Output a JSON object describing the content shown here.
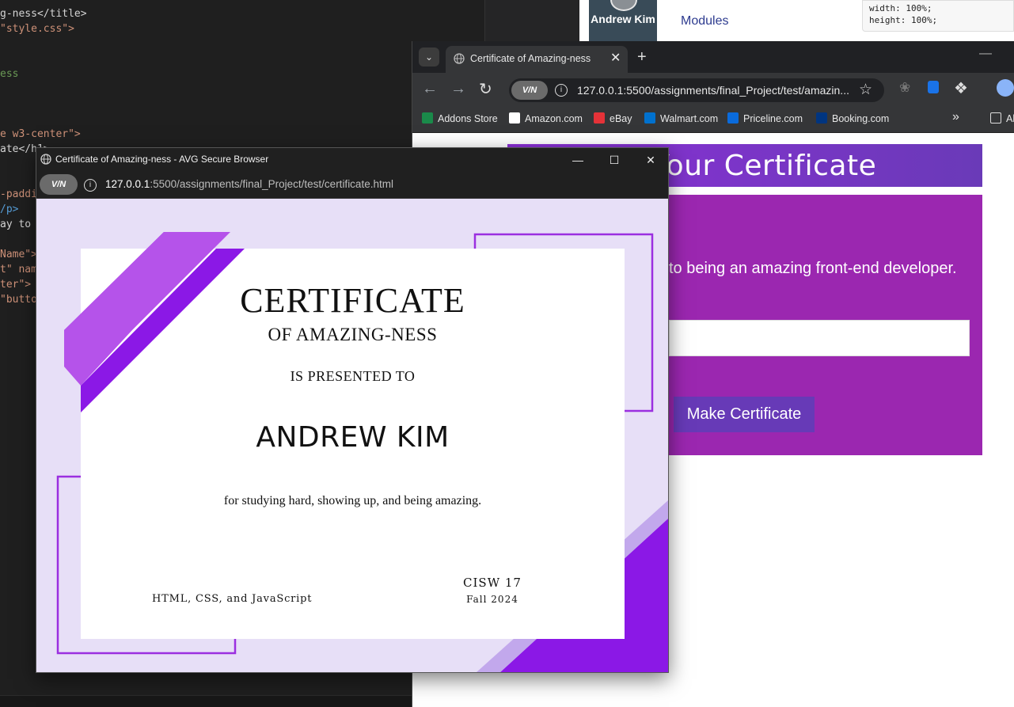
{
  "editor": {
    "lines": [
      {
        "text": "g-ness</title>",
        "cls": "c-txt"
      },
      {
        "text": "\"style.css\">",
        "cls": "c-str"
      },
      {
        "text": "",
        "cls": "c-txt"
      },
      {
        "text": "",
        "cls": "c-txt"
      },
      {
        "text": "ess",
        "cls": "c-cmt"
      },
      {
        "text": "",
        "cls": "c-txt"
      },
      {
        "text": "",
        "cls": "c-txt"
      },
      {
        "text": "",
        "cls": "c-txt"
      },
      {
        "text": "e w3-center\">",
        "cls": "c-str"
      },
      {
        "text": "ate</h1>",
        "cls": "c-txt"
      },
      {
        "text": "",
        "cls": "c-txt"
      },
      {
        "text": "",
        "cls": "c-txt"
      },
      {
        "text": "-paddi",
        "cls": "c-str"
      },
      {
        "text": "/p>",
        "cls": "c-tag"
      },
      {
        "text": "ay to",
        "cls": "c-txt"
      },
      {
        "text": "",
        "cls": "c-txt"
      },
      {
        "text": "Name\">",
        "cls": "c-str"
      },
      {
        "text": "t\" nam",
        "cls": "c-str"
      },
      {
        "text": "ter\">",
        "cls": "c-str"
      },
      {
        "text": "\"butto",
        "cls": "c-str"
      }
    ]
  },
  "canvas": {
    "user_name": "Andrew Kim",
    "modules_link": "Modules",
    "code_tip": "width: 100%;\nheight: 100%;"
  },
  "back_browser": {
    "tab_title": "Certificate of Amazing-ness",
    "url": "127.0.0.1:5500/assignments/final_Project/test/amazin...",
    "vpn_label": "V/N",
    "bookmarks": [
      {
        "label": "Addons Store",
        "color": "#1a8a4a"
      },
      {
        "label": "Amazon.com",
        "color": "#ffffff"
      },
      {
        "label": "eBay",
        "color": "#e53238"
      },
      {
        "label": "Walmart.com",
        "color": "#0071ce"
      },
      {
        "label": "Priceline.com",
        "color": "#0a6bdc"
      },
      {
        "label": "Booking.com",
        "color": "#003580"
      }
    ],
    "overflow_label": "»",
    "all_bookmarks_label": "Al",
    "page": {
      "header": "te Your Certificate",
      "description": "to being an amazing front-end developer.",
      "button_label": "Make Certificate"
    }
  },
  "front_browser": {
    "window_title": "Certificate of Amazing-ness - AVG Secure Browser",
    "vpn_label": "V/N",
    "url_host": "127.0.0.1",
    "url_rest": ":5500/assignments/final_Project/test/certificate.html",
    "certificate": {
      "title": "CERTIFICATE",
      "subtitle": "OF AMAZING-NESS",
      "presented": "IS PRESENTED TO",
      "recipient": "ANDREW KIM",
      "reason": "for studying hard, showing up, and being amazing.",
      "topics": "HTML, CSS, and JavaScript",
      "course": "CISW 17",
      "term": "Fall 2024"
    }
  },
  "colors": {
    "purple_dark": "#8b18e6",
    "purple_mid": "#b553ea",
    "purple_light": "#c2a8ec",
    "lavender_bg": "#e7dff7",
    "form_bg": "#9b27b0",
    "button_bg": "#673ab7"
  }
}
